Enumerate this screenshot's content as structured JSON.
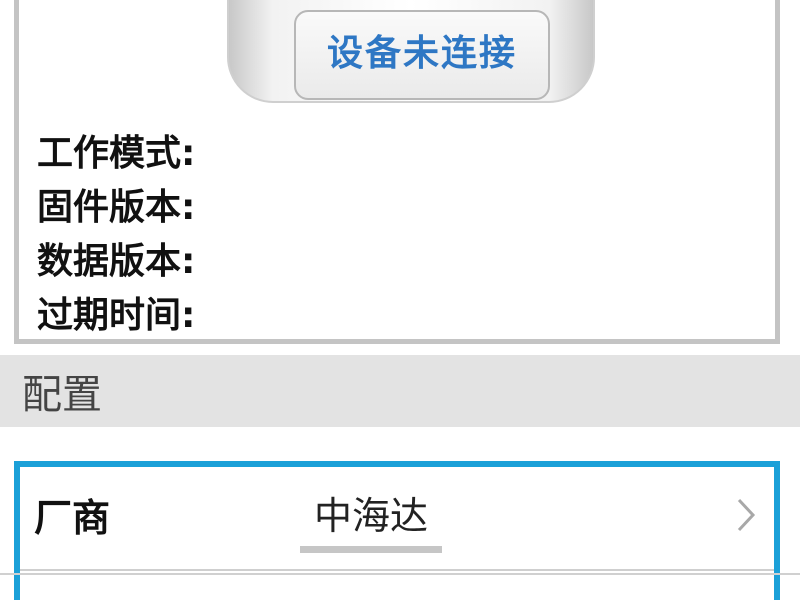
{
  "device": {
    "status_label": "设备未连接",
    "info": [
      {
        "label": "工作模式:",
        "value": ""
      },
      {
        "label": "固件版本:",
        "value": ""
      },
      {
        "label": "数据版本:",
        "value": ""
      },
      {
        "label": "过期时间:",
        "value": ""
      }
    ]
  },
  "config_section": {
    "title": "配置",
    "rows": [
      {
        "label": "厂商",
        "value": "中海达",
        "icon": "chevron-right-icon"
      }
    ]
  },
  "colors": {
    "status_text": "#2e77c4",
    "selection_border": "#1ba0d8",
    "section_bg": "#e3e3e3"
  }
}
